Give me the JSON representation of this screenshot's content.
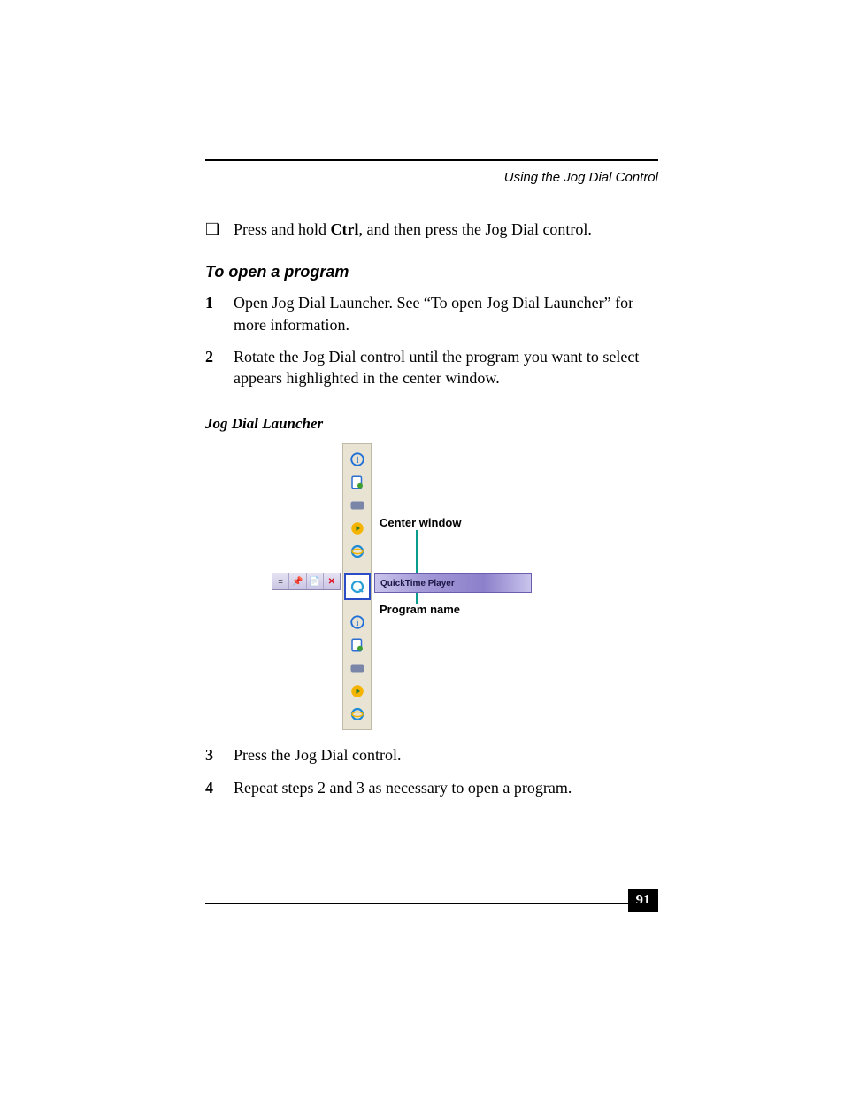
{
  "header": {
    "running_title": "Using the Jog Dial Control"
  },
  "bullet": {
    "text_before": "Press and hold ",
    "bold_key": "Ctrl",
    "text_after": ", and then press the Jog Dial control."
  },
  "section_heading": "To open a program",
  "steps": [
    {
      "num": "1",
      "text": "Open Jog Dial Launcher. See “To open Jog Dial Launcher” for more information."
    },
    {
      "num": "2",
      "text": "Rotate the Jog Dial control until the program you want to select appears highlighted in the center window."
    },
    {
      "num": "3",
      "text": "Press the Jog Dial control."
    },
    {
      "num": "4",
      "text": "Repeat steps 2 and 3 as necessary to open a program."
    }
  ],
  "figure": {
    "caption": "Jog Dial Launcher",
    "callout_center": "Center window",
    "callout_progname": "Program name",
    "selected_program": "QuickTime Player",
    "tray_close": "✕"
  },
  "page_number": "91"
}
